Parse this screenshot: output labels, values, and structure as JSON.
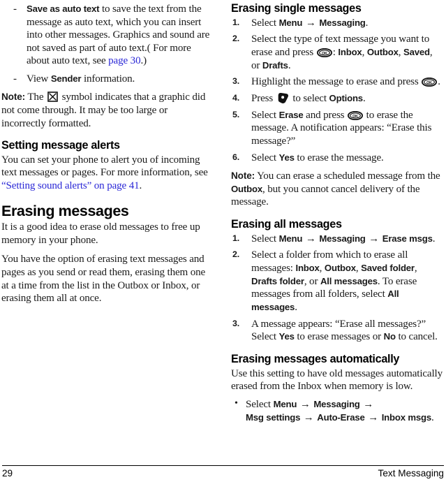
{
  "footer": {
    "page_number": "29",
    "chapter": "Text Messaging"
  },
  "colors": {
    "link": "#2a27d6",
    "text": "#1a1a1a",
    "heading": "#000000"
  },
  "left_column": {
    "dash_items": [
      {
        "lead_bold": "Save as auto text",
        "text": " to save the text from the message as auto text, which you can insert into other messages. Graphics and sound are not saved as part of auto text.( For more about auto text, see ",
        "link": "page 30",
        "tail": ".)"
      },
      {
        "pre": "View ",
        "bold": "Sender",
        "post": " information."
      }
    ],
    "note": {
      "label": "Note:",
      "pre": " The ",
      "icon": "broken-graphic-icon",
      "post": " symbol indicates that a graphic did not come through. It may be too large or incorrectly formatted."
    },
    "heading_alerts": "Setting message alerts",
    "alerts_paragraph": {
      "pre": "You can set your phone to alert you of incoming text messages or pages. For more information, see ",
      "link": "“Setting sound alerts” on page 41",
      "post": "."
    },
    "heading_erasing": "Erasing messages",
    "erasing_paragraphs": [
      "It is a good idea to erase old messages to free up memory in your phone.",
      "You have the option of erasing text messages and pages as you send or read them, erasing them one at a time from the list in the Outbox or Inbox, or erasing them all at once."
    ]
  },
  "right_column": {
    "heading_single": "Erasing single messages",
    "steps_single": [
      {
        "num": "1.",
        "parts": [
          {
            "t": "text",
            "v": "Select "
          },
          {
            "t": "ui",
            "v": "Menu"
          },
          {
            "t": "arrow",
            "v": "→"
          },
          {
            "t": "ui",
            "v": "Messaging"
          },
          {
            "t": "text",
            "v": "."
          }
        ]
      },
      {
        "num": "2.",
        "parts": [
          {
            "t": "text",
            "v": "Select the type of text message you want to erase and press "
          },
          {
            "t": "icon",
            "v": "ok-key-icon"
          },
          {
            "t": "text",
            "v": ": "
          },
          {
            "t": "ui",
            "v": "Inbox"
          },
          {
            "t": "text",
            "v": ", "
          },
          {
            "t": "ui",
            "v": "Outbox"
          },
          {
            "t": "text",
            "v": ", "
          },
          {
            "t": "ui",
            "v": "Saved"
          },
          {
            "t": "text",
            "v": ", or "
          },
          {
            "t": "ui",
            "v": "Drafts"
          },
          {
            "t": "text",
            "v": "."
          }
        ]
      },
      {
        "num": "3.",
        "parts": [
          {
            "t": "text",
            "v": "Highlight the message to erase and press "
          },
          {
            "t": "icon",
            "v": "ok-key-icon"
          },
          {
            "t": "text",
            "v": "."
          }
        ]
      },
      {
        "num": "4.",
        "parts": [
          {
            "t": "text",
            "v": "Press "
          },
          {
            "t": "icon",
            "v": "soft-key-icon"
          },
          {
            "t": "text",
            "v": " to select "
          },
          {
            "t": "ui",
            "v": "Options"
          },
          {
            "t": "text",
            "v": "."
          }
        ]
      },
      {
        "num": "5.",
        "parts": [
          {
            "t": "text",
            "v": "Select "
          },
          {
            "t": "ui",
            "v": "Erase"
          },
          {
            "t": "text",
            "v": " and press "
          },
          {
            "t": "icon",
            "v": "ok-key-icon"
          },
          {
            "t": "text",
            "v": " to erase the message. A notification appears: “Erase this message?”"
          }
        ]
      },
      {
        "num": "6.",
        "parts": [
          {
            "t": "text",
            "v": "Select "
          },
          {
            "t": "ui",
            "v": "Yes"
          },
          {
            "t": "text",
            "v": " to erase the message."
          }
        ]
      }
    ],
    "note_single": {
      "label": "Note:",
      "pre": "  You can erase a scheduled message from the ",
      "bold": "Outbox",
      "post": ", but you cannot cancel delivery of the message."
    },
    "heading_all": "Erasing all messages",
    "steps_all": [
      {
        "num": "1.",
        "parts": [
          {
            "t": "text",
            "v": "Select "
          },
          {
            "t": "ui",
            "v": "Menu"
          },
          {
            "t": "arrow",
            "v": "→"
          },
          {
            "t": "ui",
            "v": "Messaging"
          },
          {
            "t": "arrow",
            "v": "→"
          },
          {
            "t": "ui",
            "v": "Erase msgs"
          },
          {
            "t": "text",
            "v": "."
          }
        ]
      },
      {
        "num": "2.",
        "parts": [
          {
            "t": "text",
            "v": "Select a folder from which to erase all messages: "
          },
          {
            "t": "ui",
            "v": "Inbox"
          },
          {
            "t": "text",
            "v": ", "
          },
          {
            "t": "ui",
            "v": "Outbox"
          },
          {
            "t": "text",
            "v": ", "
          },
          {
            "t": "ui",
            "v": "Saved folder"
          },
          {
            "t": "text",
            "v": ", "
          },
          {
            "t": "ui",
            "v": "Drafts folder"
          },
          {
            "t": "text",
            "v": ", or "
          },
          {
            "t": "ui",
            "v": "All messages"
          },
          {
            "t": "text",
            "v": ". To erase messages from all folders, select "
          },
          {
            "t": "ui",
            "v": "All messages"
          },
          {
            "t": "text",
            "v": "."
          }
        ]
      },
      {
        "num": "3.",
        "parts": [
          {
            "t": "text",
            "v": "A message appears: “Erase all messages?” Select "
          },
          {
            "t": "ui",
            "v": "Yes"
          },
          {
            "t": "text",
            "v": " to erase messages or "
          },
          {
            "t": "ui",
            "v": "No"
          },
          {
            "t": "text",
            "v": " to cancel."
          }
        ]
      }
    ],
    "heading_auto": "Erasing messages automatically",
    "auto_paragraph": "Use this setting to have old messages automatically erased from the Inbox when memory is low.",
    "auto_bullet": {
      "parts": [
        {
          "t": "text",
          "v": "Select "
        },
        {
          "t": "ui",
          "v": "Menu"
        },
        {
          "t": "arrow",
          "v": "→"
        },
        {
          "t": "ui",
          "v": "Messaging"
        },
        {
          "t": "arrow",
          "v": "→"
        },
        {
          "t": "br",
          "v": ""
        },
        {
          "t": "ui",
          "v": "Msg settings"
        },
        {
          "t": "arrow",
          "v": "→"
        },
        {
          "t": "ui",
          "v": "Auto-Erase"
        },
        {
          "t": "arrow",
          "v": "→"
        },
        {
          "t": "ui",
          "v": "Inbox msgs"
        },
        {
          "t": "text",
          "v": "."
        }
      ]
    }
  }
}
